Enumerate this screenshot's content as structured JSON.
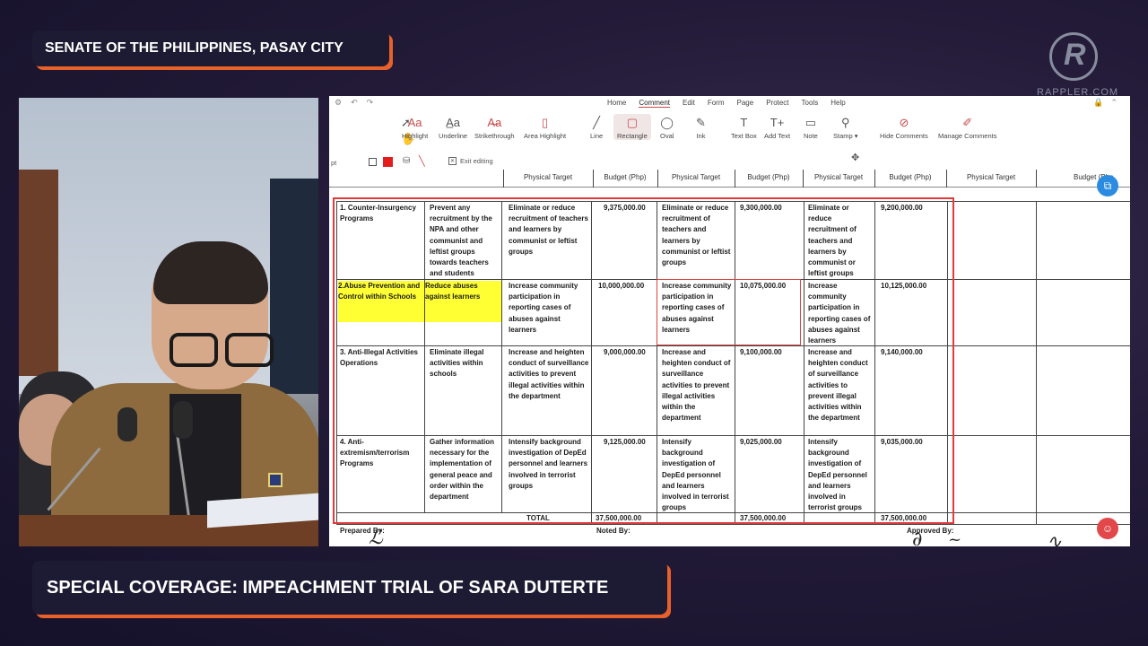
{
  "location_banner": "SENATE OF THE PHILIPPINES, PASAY CITY",
  "coverage_banner": "SPECIAL COVERAGE: IMPEACHMENT TRIAL OF SARA DUTERTE",
  "logo": {
    "mark": "R",
    "word": "RAPPLER.COM"
  },
  "viewer": {
    "menu_tabs": [
      "Home",
      "Comment",
      "Edit",
      "Form",
      "Page",
      "Protect",
      "Tools",
      "Help"
    ],
    "active_tab": "Comment",
    "tools": [
      {
        "label": "Highlight",
        "icon": "highlight-icon"
      },
      {
        "label": "Underline",
        "icon": "underline-icon"
      },
      {
        "label": "Strikethrough",
        "icon": "strikethrough-icon"
      },
      {
        "label": "Area Highlight",
        "icon": "area-highlight-icon"
      },
      {
        "label": "Line",
        "icon": "line-icon"
      },
      {
        "label": "Rectangle",
        "icon": "rectangle-icon"
      },
      {
        "label": "Oval",
        "icon": "oval-icon"
      },
      {
        "label": "Ink",
        "icon": "ink-icon"
      },
      {
        "label": "Text Box",
        "icon": "text-box-icon"
      },
      {
        "label": "Add Text",
        "icon": "add-text-icon"
      },
      {
        "label": "Note",
        "icon": "note-icon"
      },
      {
        "label": "Stamp ▾",
        "icon": "stamp-icon"
      },
      {
        "label": "Hide Comments",
        "icon": "hide-comments-icon"
      },
      {
        "label": "Manage Comments",
        "icon": "manage-comments-icon"
      }
    ],
    "sub_left": "pt",
    "exit_editing": "Exit editing",
    "stroke_color": "#e41c1c",
    "accent": "#c94a4a"
  },
  "table": {
    "headers": [
      "Physical Target",
      "Budget (Php)",
      "Physical Target",
      "Budget (Php)",
      "Physical Target",
      "Budget (Php)",
      "Physical Target",
      "Budget (Php"
    ],
    "rows": [
      {
        "program": "1. Counter-Insurgency Programs",
        "objective": "Prevent any recruitment by the NPA and other communist and leftist groups towards teachers and students",
        "target1": "Eliminate or reduce recruitment of teachers and learners by communist or leftist groups",
        "budget1": "9,375,000.00",
        "target2": "Eliminate or reduce recruitment of teachers and learners by communist or leftist groups",
        "budget2": "9,300,000.00",
        "target3": "Eliminate or reduce recruitment of teachers and learners by communist or leftist groups",
        "budget3": "9,200,000.00"
      },
      {
        "program": "2.Abuse Prevention and Control within Schools",
        "objective": "Reduce abuses against learners",
        "target1": "Increase community participation in reporting cases of abuses against learners",
        "budget1": "10,000,000.00",
        "target2": "Increase community participation in reporting cases of abuses against learners",
        "budget2": "10,075,000.00",
        "target3": "Increase community participation in reporting cases of abuses against learners",
        "budget3": "10,125,000.00"
      },
      {
        "program": "3. Anti-Illegal Activities Operations",
        "objective": "Eliminate illegal activities within schools",
        "target1": "Increase and heighten conduct of surveillance activities to prevent illegal activities within the department",
        "budget1": "9,000,000.00",
        "target2": "Increase and heighten conduct of surveillance activities to prevent illegal activities within the department",
        "budget2": "9,100,000.00",
        "target3": "Increase and heighten conduct of surveillance activities to prevent illegal activities within the department",
        "budget3": "9,140,000.00"
      },
      {
        "program": "4. Anti-extremism/terrorism Programs",
        "objective": "Gather information necessary for the implementation of general peace and order within the department",
        "target1": "Intensify background investigation of DepEd personnel and learners involved in terrorist groups",
        "budget1": "9,125,000.00",
        "target2": "Intensify background investigation of DepEd personnel and learners involved in terrorist groups",
        "budget2": "9,025,000.00",
        "target3": "Intensify background investigation of DepEd personnel and learners involved in terrorist groups",
        "budget3": "9,035,000.00"
      }
    ],
    "total_label": "TOTAL",
    "totals": [
      "37,500,000.00",
      "37,500,000.00",
      "37,500,000.00"
    ],
    "footer": {
      "prepared": "Prepared By:",
      "noted": "Noted By:",
      "approved": "Approved By:"
    }
  }
}
